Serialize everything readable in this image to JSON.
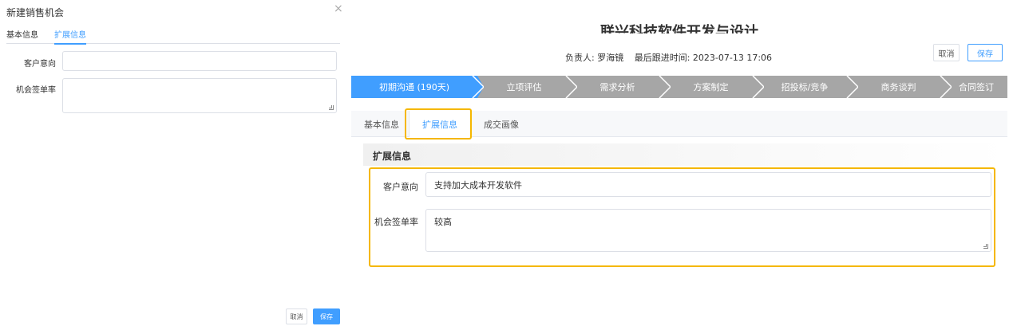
{
  "dialog": {
    "title": "新建销售机会",
    "close_glyph": "×",
    "tabs": [
      {
        "label": "基本信息"
      },
      {
        "label": "扩展信息"
      }
    ],
    "fields": [
      {
        "label": "客户意向",
        "value": ""
      },
      {
        "label": "机会签单率",
        "value": ""
      }
    ],
    "cancel_label": "取消",
    "save_label": "保存"
  },
  "detail": {
    "title": "联兴科技软件开发与设计",
    "owner": "负责人: 罗海镜",
    "last_follow": "最后跟进时间: 2023-07-13 17:06",
    "cancel_label": "取消",
    "save_label": "保存",
    "stages": [
      {
        "label": "初期沟通 (190天)"
      },
      {
        "label": "立项评估"
      },
      {
        "label": "需求分析"
      },
      {
        "label": "方案制定"
      },
      {
        "label": "招投标/竞争"
      },
      {
        "label": "商务谈判"
      },
      {
        "label": "合同签订"
      }
    ],
    "tabs": [
      {
        "label": "基本信息"
      },
      {
        "label": "扩展信息"
      },
      {
        "label": "成交画像"
      }
    ],
    "section_title": "扩展信息",
    "fields": [
      {
        "label": "客户意向",
        "value": "支持加大成本开发软件"
      },
      {
        "label": "机会签单率",
        "value": "较高"
      }
    ]
  },
  "colors": {
    "accent": "#409eff",
    "highlight": "#f5b700",
    "stage_inactive": "#a6a6a6"
  }
}
